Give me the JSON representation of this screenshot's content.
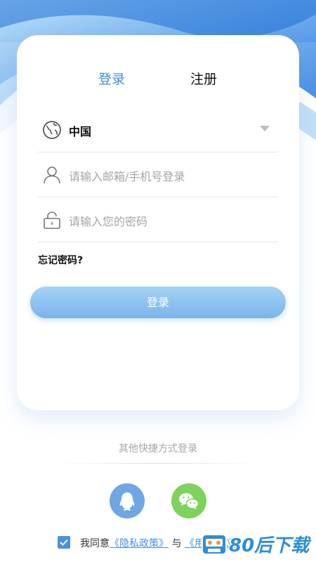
{
  "tabs": {
    "login": "登录",
    "register": "注册"
  },
  "country": {
    "value": "中国"
  },
  "email": {
    "placeholder": "请输入邮箱/手机号登录"
  },
  "password": {
    "placeholder": "请输入您的密码"
  },
  "forgot_password": "忘记密码?",
  "login_button": "登录",
  "quick_login": {
    "title": "其他快捷方式登录",
    "options": [
      "qq-icon",
      "wechat-icon"
    ]
  },
  "agreement": {
    "checked": true,
    "prefix": "我同意",
    "privacy_link": "《隐私政策》",
    "and": "与",
    "user_agreement_link": "《用户协议》"
  },
  "watermark": {
    "text": "80后下载"
  },
  "colors": {
    "accent": "#3d8fd8",
    "button_top": "#a3d3f5",
    "button_bottom": "#7bb4ea",
    "qq": "#6fa6e4",
    "wechat": "#7ed35c"
  }
}
